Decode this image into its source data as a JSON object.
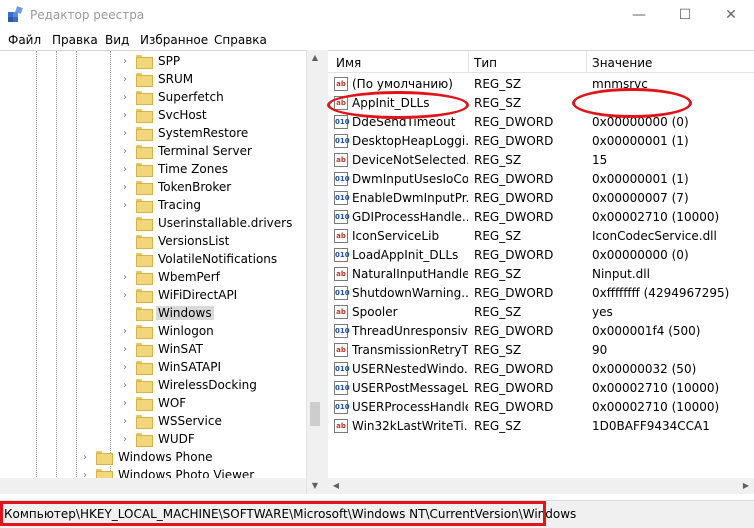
{
  "window": {
    "title": "Редактор реестра",
    "minimize": "—",
    "maximize": "☐",
    "close": "✕"
  },
  "menu": [
    "Файл",
    "Правка",
    "Вид",
    "Избранное",
    "Справка"
  ],
  "tree": {
    "items": [
      {
        "label": "SPP",
        "expandable": true
      },
      {
        "label": "SRUM",
        "expandable": true
      },
      {
        "label": "Superfetch",
        "expandable": true
      },
      {
        "label": "SvcHost",
        "expandable": true
      },
      {
        "label": "SystemRestore",
        "expandable": true
      },
      {
        "label": "Terminal Server",
        "expandable": true
      },
      {
        "label": "Time Zones",
        "expandable": true
      },
      {
        "label": "TokenBroker",
        "expandable": true
      },
      {
        "label": "Tracing",
        "expandable": true
      },
      {
        "label": "Userinstallable.drivers",
        "expandable": false
      },
      {
        "label": "VersionsList",
        "expandable": false
      },
      {
        "label": "VolatileNotifications",
        "expandable": false
      },
      {
        "label": "WbemPerf",
        "expandable": true
      },
      {
        "label": "WiFiDirectAPI",
        "expandable": true
      },
      {
        "label": "Windows",
        "expandable": false,
        "selected": true
      },
      {
        "label": "Winlogon",
        "expandable": true
      },
      {
        "label": "WinSAT",
        "expandable": true
      },
      {
        "label": "WinSATAPI",
        "expandable": true
      },
      {
        "label": "WirelessDocking",
        "expandable": true
      },
      {
        "label": "WOF",
        "expandable": true
      },
      {
        "label": "WSService",
        "expandable": true
      },
      {
        "label": "WUDF",
        "expandable": true
      },
      {
        "label": "Windows Phone",
        "expandable": true,
        "level": 0
      },
      {
        "label": "Windows Photo Viewer",
        "expandable": true,
        "level": 0
      }
    ]
  },
  "list": {
    "columns": {
      "name": "Имя",
      "type": "Тип",
      "value": "Значение"
    },
    "rows": [
      {
        "name": "(По умолчанию)",
        "type": "REG_SZ",
        "value": "mnmsrvc",
        "icon": "string-value-icon"
      },
      {
        "name": "AppInit_DLLs",
        "type": "REG_SZ",
        "value": "",
        "icon": "string-value-icon"
      },
      {
        "name": "DdeSendTimeout",
        "type": "REG_DWORD",
        "value": "0x00000000 (0)",
        "icon": "dword-value-icon"
      },
      {
        "name": "DesktopHeapLoggi...",
        "type": "REG_DWORD",
        "value": "0x00000001 (1)",
        "icon": "dword-value-icon"
      },
      {
        "name": "DeviceNotSelected...",
        "type": "REG_SZ",
        "value": "15",
        "icon": "string-value-icon"
      },
      {
        "name": "DwmInputUsesIoCo...",
        "type": "REG_DWORD",
        "value": "0x00000001 (1)",
        "icon": "dword-value-icon"
      },
      {
        "name": "EnableDwmInputPr...",
        "type": "REG_DWORD",
        "value": "0x00000007 (7)",
        "icon": "dword-value-icon"
      },
      {
        "name": "GDIProcessHandle...",
        "type": "REG_DWORD",
        "value": "0x00002710 (10000)",
        "icon": "dword-value-icon"
      },
      {
        "name": "IconServiceLib",
        "type": "REG_SZ",
        "value": "IconCodecService.dll",
        "icon": "string-value-icon"
      },
      {
        "name": "LoadAppInit_DLLs",
        "type": "REG_DWORD",
        "value": "0x00000000 (0)",
        "icon": "dword-value-icon"
      },
      {
        "name": "NaturalInputHandler",
        "type": "REG_SZ",
        "value": "Ninput.dll",
        "icon": "string-value-icon"
      },
      {
        "name": "ShutdownWarning...",
        "type": "REG_DWORD",
        "value": "0xffffffff (4294967295)",
        "icon": "dword-value-icon"
      },
      {
        "name": "Spooler",
        "type": "REG_SZ",
        "value": "yes",
        "icon": "string-value-icon"
      },
      {
        "name": "ThreadUnresponsiv...",
        "type": "REG_DWORD",
        "value": "0x000001f4 (500)",
        "icon": "dword-value-icon"
      },
      {
        "name": "TransmissionRetryT...",
        "type": "REG_SZ",
        "value": "90",
        "icon": "string-value-icon"
      },
      {
        "name": "USERNestedWindo...",
        "type": "REG_DWORD",
        "value": "0x00000032 (50)",
        "icon": "dword-value-icon"
      },
      {
        "name": "USERPostMessageLi...",
        "type": "REG_DWORD",
        "value": "0x00002710 (10000)",
        "icon": "dword-value-icon"
      },
      {
        "name": "USERProcessHandle...",
        "type": "REG_DWORD",
        "value": "0x00002710 (10000)",
        "icon": "dword-value-icon"
      },
      {
        "name": "Win32kLastWriteTi...",
        "type": "REG_SZ",
        "value": "1D0BAFF9434CCA1",
        "icon": "string-value-icon"
      }
    ]
  },
  "icon_glyphs": {
    "string": "ab",
    "dword": "010"
  },
  "status": {
    "path": "Компьютер\\HKEY_LOCAL_MACHINE\\SOFTWARE\\Microsoft\\Windows NT\\CurrentVersion\\Windows"
  },
  "colors": {
    "highlight": "#e0141b",
    "selection": "#d9d9d9"
  }
}
